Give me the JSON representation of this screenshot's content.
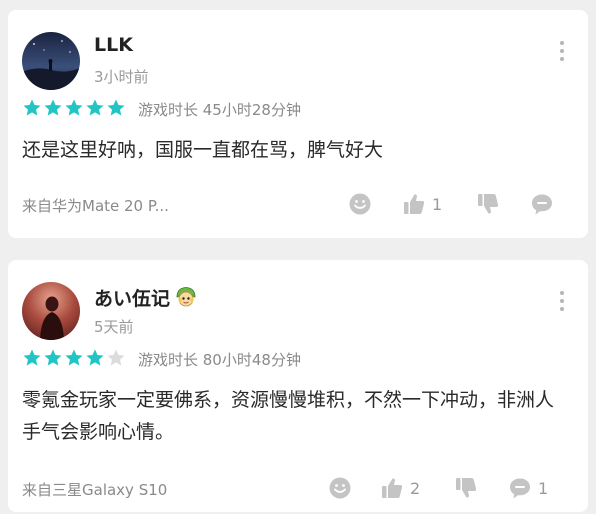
{
  "colors": {
    "star_filled": "#22c4c4",
    "star_empty": "#dcdcdc",
    "icon_gray": "#c0c0c0",
    "muted_text": "#8a8a8a"
  },
  "reviews": [
    {
      "username": "LLK",
      "time": "3小时前",
      "rating": 5,
      "playtime": "游戏时长 45小时28分钟",
      "content": "还是这里好呐，国服一直都在骂，脾气好大",
      "device": "来自华为Mate 20 P...",
      "likes": "1",
      "comments": ""
    },
    {
      "username": "あい伍记",
      "time": "5天前",
      "rating": 4,
      "playtime": "游戏时长 80小时48分钟",
      "content": "零氪金玩家一定要佛系，资源慢慢堆积，不然一下冲动，非洲人手气会影响心情。",
      "device": "来自三星Galaxy S10",
      "likes": "2",
      "comments": "1"
    }
  ]
}
